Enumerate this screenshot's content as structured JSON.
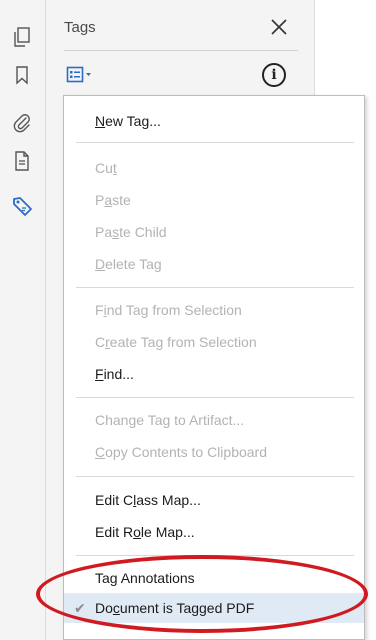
{
  "panel": {
    "title": "Tags"
  },
  "menu": {
    "items": [
      {
        "pre": "",
        "u": "N",
        "post": "ew Tag...",
        "enabled": true
      },
      {
        "pre": "Cu",
        "u": "t",
        "post": "",
        "enabled": false
      },
      {
        "pre": "P",
        "u": "a",
        "post": "ste",
        "enabled": false
      },
      {
        "pre": "Pa",
        "u": "s",
        "post": "te Child",
        "enabled": false
      },
      {
        "pre": "",
        "u": "D",
        "post": "elete Tag",
        "enabled": false
      },
      {
        "pre": "F",
        "u": "i",
        "post": "nd Tag from Selection",
        "enabled": false
      },
      {
        "pre": "C",
        "u": "r",
        "post": "eate Tag from Selection",
        "enabled": false
      },
      {
        "pre": "",
        "u": "F",
        "post": "ind...",
        "enabled": true
      },
      {
        "pre": "Chan",
        "u": "g",
        "post": "e Tag to Artifact...",
        "enabled": false
      },
      {
        "pre": "",
        "u": "C",
        "post": "opy Contents to Clipboard",
        "enabled": false
      },
      {
        "pre": "Edit C",
        "u": "l",
        "post": "ass Map...",
        "enabled": true
      },
      {
        "pre": "Edit R",
        "u": "o",
        "post": "le Map...",
        "enabled": true
      },
      {
        "pre": "Ta",
        "u": "g",
        "post": " Annotations",
        "enabled": true
      },
      {
        "pre": "Do",
        "u": "c",
        "post": "ument is Tagged PDF",
        "enabled": true,
        "checked": true
      }
    ]
  },
  "colors": {
    "accent_blue": "#2b6cc4",
    "annotation_red": "#d11a1f",
    "checked_bg": "#dfeaf5",
    "disabled_text": "#b3b3b3"
  },
  "icons": {
    "rail": [
      "pages-icon",
      "bookmark-icon",
      "attachment-icon",
      "document-properties-icon",
      "tag-icon"
    ],
    "panel": [
      "options-menu-icon",
      "close-icon",
      "info-icon"
    ]
  }
}
